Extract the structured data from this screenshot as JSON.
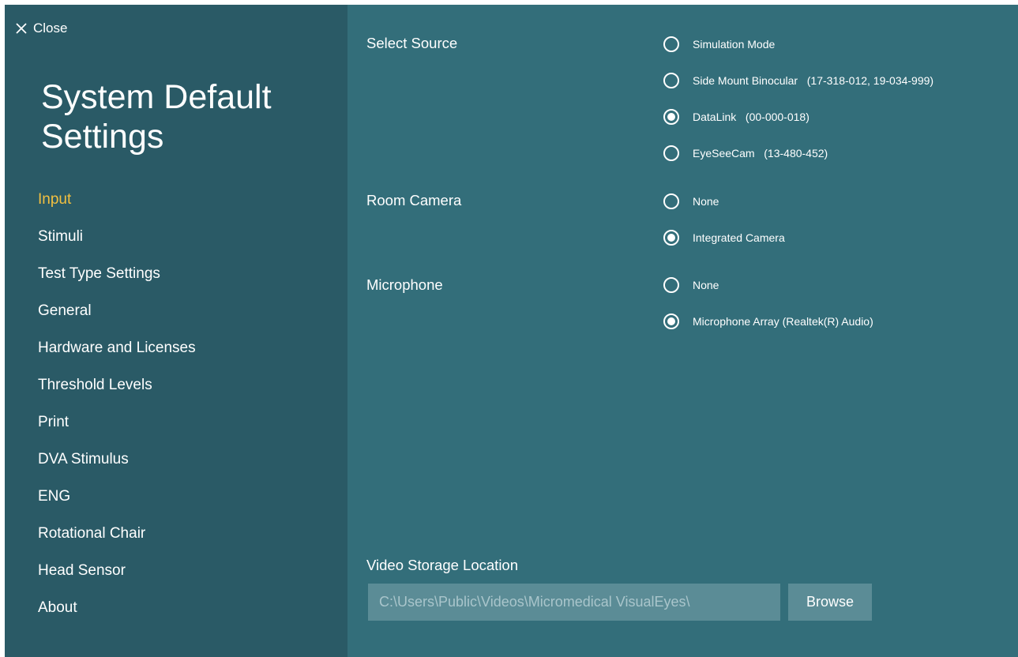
{
  "close_label": "Close",
  "title": {
    "line1": "System Default",
    "line2": "Settings"
  },
  "colors": {
    "sidebar_bg": "#2a5a66",
    "main_bg": "#336e7a",
    "active_nav": "#f2c040",
    "input_bg": "#5b8c96"
  },
  "nav": [
    {
      "label": "Input",
      "active": true
    },
    {
      "label": "Stimuli"
    },
    {
      "label": "Test Type Settings"
    },
    {
      "label": "General"
    },
    {
      "label": "Hardware and Licenses"
    },
    {
      "label": "Threshold Levels"
    },
    {
      "label": "Print"
    },
    {
      "label": "DVA Stimulus"
    },
    {
      "label": "ENG"
    },
    {
      "label": "Rotational Chair"
    },
    {
      "label": "Head Sensor"
    },
    {
      "label": "About"
    }
  ],
  "select_source": {
    "label": "Select Source",
    "options": [
      {
        "label": "Simulation Mode",
        "checked": false
      },
      {
        "label": "Side Mount Binocular   (17-318-012, 19-034-999)",
        "checked": false
      },
      {
        "label": "DataLink   (00-000-018)",
        "checked": true
      },
      {
        "label": "EyeSeeCam   (13-480-452)",
        "checked": false
      }
    ]
  },
  "room_camera": {
    "label": "Room Camera",
    "options": [
      {
        "label": "None",
        "checked": false
      },
      {
        "label": "Integrated Camera",
        "checked": true
      }
    ]
  },
  "microphone": {
    "label": "Microphone",
    "options": [
      {
        "label": "None",
        "checked": false
      },
      {
        "label": "Microphone Array (Realtek(R) Audio)",
        "checked": true
      }
    ]
  },
  "video_storage": {
    "label": "Video Storage Location",
    "path": "C:\\Users\\Public\\Videos\\Micromedical VisualEyes\\",
    "browse_label": "Browse"
  }
}
